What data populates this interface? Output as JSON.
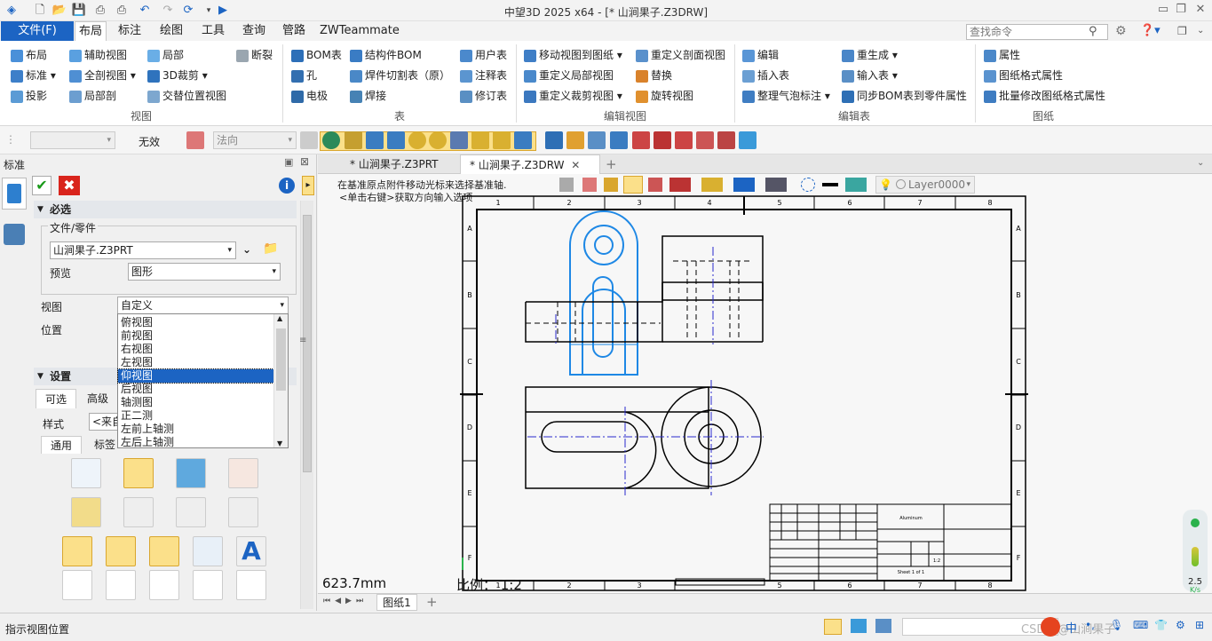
{
  "app": {
    "window_title": "中望3D 2025 x64 - [* 山涧果子.Z3DRW]"
  },
  "menu": {
    "file": "文件(F)",
    "tabs": [
      "布局",
      "标注",
      "绘图",
      "工具",
      "查询",
      "管路",
      "ZWTeammate"
    ],
    "active_tab": "布局",
    "search_placeholder": "查找命令"
  },
  "ribbon": {
    "view_group": {
      "label": "视图",
      "items": [
        "布局",
        "辅助视图",
        "局部",
        "断裂",
        "标准",
        "全剖视图",
        "3D裁剪",
        "投影",
        "局部剖",
        "交替位置视图"
      ]
    },
    "table_group": {
      "label": "表",
      "items": [
        "BOM表",
        "结构件BOM",
        "用户表",
        "孔",
        "焊件切割表（原）",
        "注释表",
        "电极",
        "焊接",
        "修订表"
      ]
    },
    "edit_view_group": {
      "label": "编辑视图",
      "items": [
        "移动视图到图纸",
        "重定义剖面视图",
        "重定义局部视图",
        "替换",
        "重定义裁剪视图",
        "旋转视图"
      ]
    },
    "edit_table_group": {
      "label": "编辑表",
      "items": [
        "编辑",
        "重生成",
        "插入表",
        "输入表",
        "整理气泡标注",
        "同步BOM表到零件属性"
      ]
    },
    "sheet_group": {
      "label": "图纸",
      "items": [
        "属性",
        "图纸格式属性",
        "批量修改图纸格式属性"
      ]
    }
  },
  "toolbar": {
    "filter_value": "无效",
    "direction_value": "法向"
  },
  "panel": {
    "title": "标准",
    "required_section": "必选",
    "file_part_label": "文件/零件",
    "file_value": "山涧果子.Z3PRT",
    "preview_label": "预览",
    "preview_value": "图形",
    "view_label": "视图",
    "view_value": "自定义",
    "position_label": "位置",
    "view_options": [
      "俯视图",
      "前视图",
      "右视图",
      "左视图",
      "仰视图",
      "后视图",
      "轴测图",
      "正二测",
      "左前上轴测",
      "左后上轴测"
    ],
    "selected_option": "仰视图",
    "settings_section": "设置",
    "tabs": [
      "可选",
      "高级"
    ],
    "style_label": "样式",
    "style_value": "<来自",
    "sub_tabs": [
      "通用",
      "标签"
    ]
  },
  "doc_tabs": [
    "* 山涧果子.Z3PRT",
    "* 山涧果子.Z3DRW"
  ],
  "active_doc": "* 山涧果子.Z3DRW",
  "canvas": {
    "hint_line1": "在基准原点附件移动光标来选择基准轴.",
    "hint_line2": "<单击右键>获取方向输入选项",
    "layer": "Layer0000",
    "measure": "623.7mm",
    "scale_label": "比例： 1:2",
    "col_labels": [
      "1",
      "2",
      "3",
      "4",
      "5",
      "6",
      "7",
      "8"
    ],
    "row_labels": [
      "A",
      "B",
      "C",
      "D",
      "E",
      "F"
    ],
    "title_block": {
      "material": "Aluminum",
      "sheet_text": "Sheet 1 of 1",
      "scale_val": "1:2"
    }
  },
  "sheet_tab": "图纸1",
  "status": {
    "text": "指示视图位置",
    "watermark": "CSDN @山涧果子",
    "speed_value": "2.5",
    "speed_unit": "K/s"
  },
  "colors": {
    "accent": "#1c64c3",
    "view_highlight": "#1e88e5",
    "centerline": "#2a2acc"
  }
}
